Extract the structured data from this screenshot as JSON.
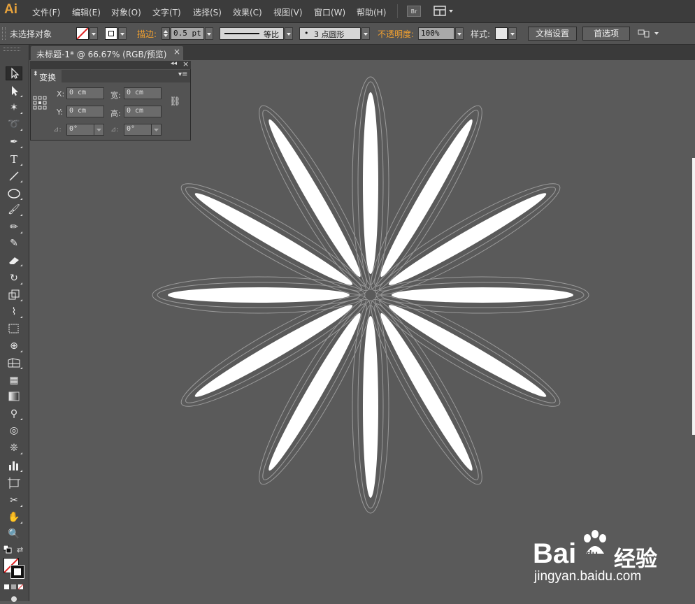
{
  "app": {
    "logo": "Ai"
  },
  "menu": {
    "items": [
      "文件(F)",
      "编辑(E)",
      "对象(O)",
      "文字(T)",
      "选择(S)",
      "效果(C)",
      "视图(V)",
      "窗口(W)",
      "帮助(H)"
    ],
    "bridge_label": "Br"
  },
  "control": {
    "selection_status": "未选择对象",
    "stroke_label": "描边:",
    "stroke_weight": "0.5 pt",
    "stroke_profile": "等比",
    "brush": "3 点圆形",
    "brush_dot": "•",
    "opacity_label": "不透明度:",
    "opacity_value": "100%",
    "style_label": "样式:",
    "doc_setup": "文档设置",
    "preferences": "首选项"
  },
  "document": {
    "tab_title": "未标题-1* @ 66.67% (RGB/预览)",
    "tab_close": "×"
  },
  "transform_panel": {
    "title": "变换",
    "x_label": "X:",
    "x_value": "0 cm",
    "y_label": "Y:",
    "y_value": "0 cm",
    "w_label": "宽:",
    "w_value": "0 cm",
    "h_label": "高:",
    "h_value": "0 cm",
    "rotate_value": "0°",
    "shear_value": "0°"
  },
  "tools": [
    "selection",
    "direct-selection",
    "magic-wand",
    "lasso",
    "pen",
    "type",
    "line-segment",
    "ellipse",
    "paintbrush",
    "pencil",
    "blob-brush",
    "eraser",
    "rotate",
    "scale",
    "width",
    "free-transform",
    "shape-builder",
    "perspective-grid",
    "mesh",
    "gradient",
    "eyedropper",
    "blend",
    "symbol-sprayer",
    "column-graph",
    "artboard",
    "slice",
    "hand",
    "zoom"
  ],
  "artwork": {
    "petal_count": 12,
    "petal_color": "#ffffff",
    "outline_color": "#9a9a9a"
  },
  "watermark": {
    "brand": "Bai",
    "paw": "du",
    "suffix": "经验",
    "url": "jingyan.baidu.com"
  },
  "colors": {
    "canvas": "#5a5a5a",
    "accent": "#e8a33c",
    "link": "#f0a030"
  }
}
